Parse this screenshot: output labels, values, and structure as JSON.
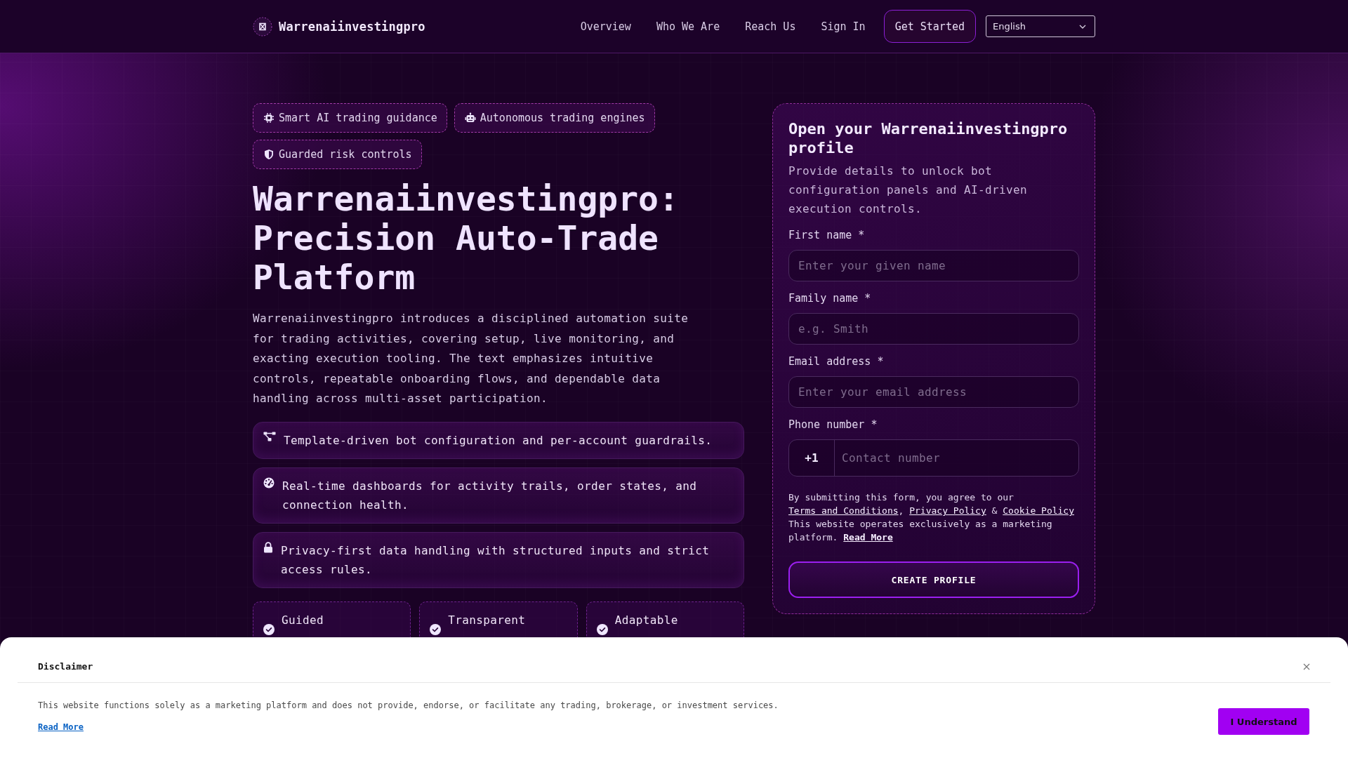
{
  "header": {
    "brand": "Warrenaiinvestingpro",
    "nav": [
      "Overview",
      "Who We Are",
      "Reach Us",
      "Sign In"
    ],
    "cta": "Get Started",
    "language": "English"
  },
  "hero": {
    "badges": [
      "Smart AI trading guidance",
      "Autonomous trading engines",
      "Guarded risk controls"
    ],
    "title": "Warrenaiinvestingpro: Precision Auto-Trade Platform",
    "description": "Warrenaiinvestingpro introduces a disciplined automation suite for trading activities, covering setup, live monitoring, and exacting execution tooling. The text emphasizes intuitive controls, repeatable onboarding flows, and dependable data handling across multi-asset participation.",
    "features": [
      "Template-driven bot configuration and per-account guardrails.",
      "Real-time dashboards for activity trails, order states, and connection health.",
      "Privacy-first data handling with structured inputs and strict access rules."
    ],
    "highlights": [
      "Guided",
      "Transparent",
      "Adaptable"
    ]
  },
  "form": {
    "title": "Open your Warrenaiinvestingpro profile",
    "subtitle": "Provide details to unlock bot configuration panels and AI-driven execution controls.",
    "fields": [
      {
        "kind": "text",
        "label": "First name *",
        "placeholder": "Enter your given name"
      },
      {
        "kind": "text",
        "label": "Family name *",
        "placeholder": "e.g. Smith"
      },
      {
        "kind": "text",
        "label": "Email address *",
        "placeholder": "Enter your email address"
      },
      {
        "kind": "phone",
        "label": "Phone number *",
        "prefix": "+1",
        "placeholder": "Contact number"
      }
    ],
    "consent": [
      {
        "kind": "text",
        "text": "By submitting this form, you agree to our "
      },
      {
        "kind": "link",
        "text": "Terms and Conditions"
      },
      {
        "kind": "text",
        "text": ", "
      },
      {
        "kind": "link",
        "text": "Privacy Policy"
      },
      {
        "kind": "text",
        "text": " & "
      },
      {
        "kind": "link",
        "text": "Cookie Policy"
      },
      {
        "kind": "text",
        "text": " This website operates exclusively as a marketing platform. "
      },
      {
        "kind": "strong-link",
        "text": "Read More"
      }
    ],
    "submit": "CREATE PROFILE"
  },
  "disclaimer": {
    "title": "Disclaimer",
    "text": "This website functions solely as a marketing platform and does not provide, endorse, or facilitate any trading, brokerage, or investment services.",
    "link": "Read More",
    "button": "I Understand"
  }
}
